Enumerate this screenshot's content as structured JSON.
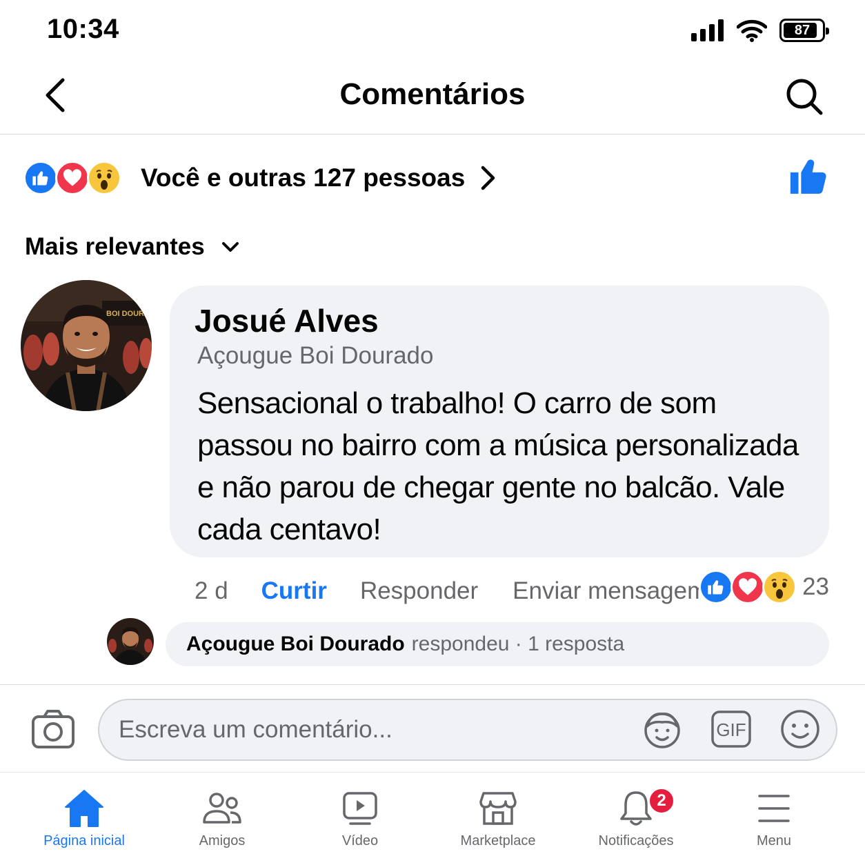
{
  "status_bar": {
    "time": "10:34",
    "battery": "87"
  },
  "header": {
    "title": "Comentários"
  },
  "reactions_summary": {
    "text": "Você e outras 127 pessoas",
    "icons": [
      "like-icon",
      "love-icon",
      "wow-icon"
    ]
  },
  "sort": {
    "label": "Mais relevantes"
  },
  "comment": {
    "author": "Josué Alves",
    "subtitle": "Açougue Boi Dourado",
    "text": "Sensacional o trabalho! O carro de som passou no bairro com a música personalizada e não parou de chegar gente no balcão. Vale cada centavo!",
    "time": "2 d",
    "like_label": "Curtir",
    "reply_label": "Responder",
    "message_label": "Enviar mensagem",
    "reaction_count": "23",
    "avatar_sign_text": "BOI DOURADO"
  },
  "reply_preview": {
    "author": "Açougue Boi Dourado",
    "meta": "respondeu · 1 resposta"
  },
  "composer": {
    "placeholder": "Escreva um comentário...",
    "gif_label": "GIF"
  },
  "bottom_nav": {
    "items": [
      {
        "label": "Página inicial",
        "icon": "home-icon",
        "active": true
      },
      {
        "label": "Amigos",
        "icon": "friends-icon"
      },
      {
        "label": "Vídeo",
        "icon": "video-icon"
      },
      {
        "label": "Marketplace",
        "icon": "marketplace-icon"
      },
      {
        "label": "Notificações",
        "icon": "bell-icon",
        "badge": "2"
      },
      {
        "label": "Menu",
        "icon": "menu-icon"
      }
    ]
  },
  "colors": {
    "accent": "#1877f2",
    "love": "#f0364d",
    "wow": "#f7c63c",
    "bubble": "#f0f2f5",
    "secondary_text": "#65676b",
    "badge": "#e41e3f"
  }
}
